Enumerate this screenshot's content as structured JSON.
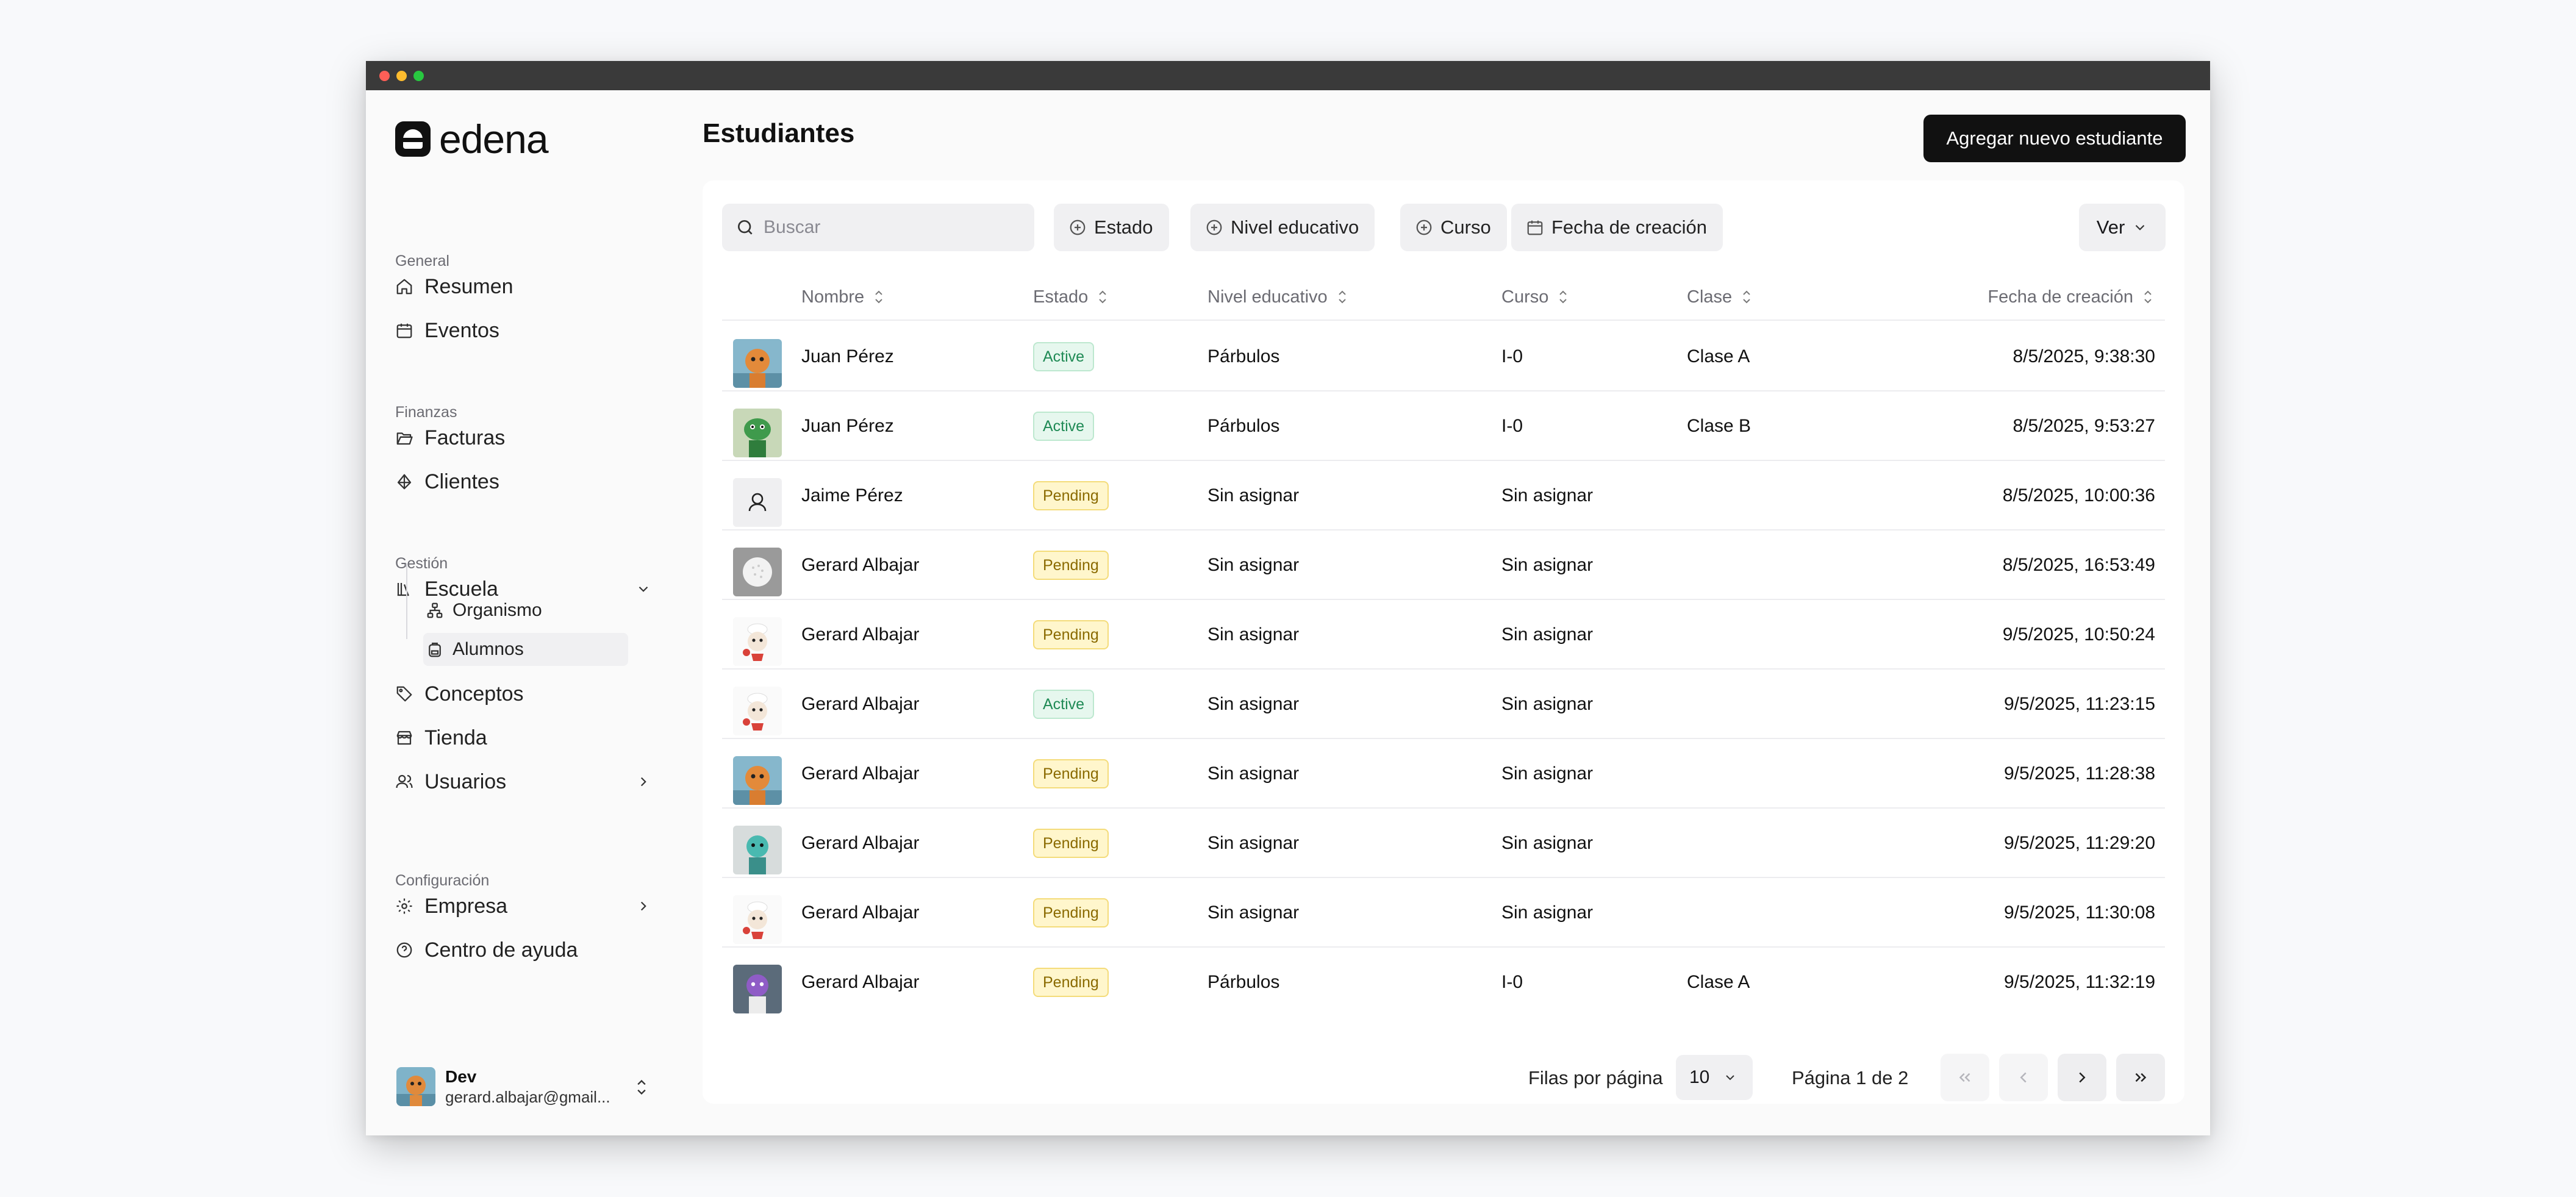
{
  "brand": {
    "logo_text": "edena"
  },
  "sidebar": {
    "sections": [
      {
        "label": "General"
      },
      {
        "label": "Finanzas"
      },
      {
        "label": "Gestión"
      },
      {
        "label": "Configuración"
      }
    ],
    "items": {
      "resumen": "Resumen",
      "eventos": "Eventos",
      "facturas": "Facturas",
      "clientes": "Clientes",
      "escuela": "Escuela",
      "organismo": "Organismo",
      "alumnos": "Alumnos",
      "conceptos": "Conceptos",
      "tienda": "Tienda",
      "usuarios": "Usuarios",
      "empresa": "Empresa",
      "ayuda": "Centro de ayuda"
    },
    "user": {
      "name": "Dev",
      "email": "gerard.albajar@gmail..."
    }
  },
  "header": {
    "title": "Estudiantes",
    "add_button": "Agregar nuevo estudiante"
  },
  "toolbar": {
    "search_placeholder": "Buscar",
    "filters": [
      "Estado",
      "Nivel educativo",
      "Curso",
      "Fecha de creación"
    ],
    "view_label": "Ver"
  },
  "table": {
    "columns": [
      "Nombre",
      "Estado",
      "Nivel educativo",
      "Curso",
      "Clase",
      "Fecha de creación"
    ],
    "rows": [
      {
        "avatar": "orange-creature",
        "name": "Juan Pérez",
        "status": "Active",
        "level": "Párbulos",
        "course": "I-0",
        "class": "Clase A",
        "created": "8/5/2025, 9:38:30"
      },
      {
        "avatar": "green-creature",
        "name": "Juan Pérez",
        "status": "Active",
        "level": "Párbulos",
        "course": "I-0",
        "class": "Clase B",
        "created": "8/5/2025, 9:53:27"
      },
      {
        "avatar": "placeholder-user",
        "name": "Jaime Pérez",
        "status": "Pending",
        "level": "Sin asignar",
        "course": "Sin asignar",
        "class": "",
        "created": "8/5/2025, 10:00:36"
      },
      {
        "avatar": "golf-ball",
        "name": "Gerard Albajar",
        "status": "Pending",
        "level": "Sin asignar",
        "course": "Sin asignar",
        "class": "",
        "created": "8/5/2025, 16:53:49"
      },
      {
        "avatar": "chef-creature",
        "name": "Gerard Albajar",
        "status": "Pending",
        "level": "Sin asignar",
        "course": "Sin asignar",
        "class": "",
        "created": "9/5/2025, 10:50:24"
      },
      {
        "avatar": "chef-creature",
        "name": "Gerard Albajar",
        "status": "Active",
        "level": "Sin asignar",
        "course": "Sin asignar",
        "class": "",
        "created": "9/5/2025, 11:23:15"
      },
      {
        "avatar": "orange-creature",
        "name": "Gerard Albajar",
        "status": "Pending",
        "level": "Sin asignar",
        "course": "Sin asignar",
        "class": "",
        "created": "9/5/2025, 11:28:38"
      },
      {
        "avatar": "teal-creature",
        "name": "Gerard Albajar",
        "status": "Pending",
        "level": "Sin asignar",
        "course": "Sin asignar",
        "class": "",
        "created": "9/5/2025, 11:29:20"
      },
      {
        "avatar": "chef-creature",
        "name": "Gerard Albajar",
        "status": "Pending",
        "level": "Sin asignar",
        "course": "Sin asignar",
        "class": "",
        "created": "9/5/2025, 11:30:08"
      },
      {
        "avatar": "purple-creature",
        "name": "Gerard Albajar",
        "status": "Pending",
        "level": "Párbulos",
        "course": "I-0",
        "class": "Clase A",
        "created": "9/5/2025, 11:32:19"
      }
    ]
  },
  "pagination": {
    "rows_per_page_label": "Filas por página",
    "rows_per_page_value": "10",
    "page_label": "Página 1 de 2"
  },
  "colors": {
    "primary": "#111111",
    "active_badge_bg": "#e6f7ee",
    "active_badge_text": "#1f8a55",
    "pending_badge_bg": "#fff6cc",
    "pending_badge_text": "#8a6a00"
  }
}
